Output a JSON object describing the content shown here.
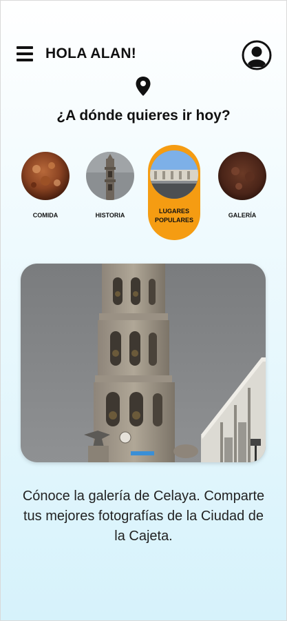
{
  "header": {
    "greeting": "HOLA ALAN!"
  },
  "prompt": "¿A dónde quieres ir hoy?",
  "categories": [
    {
      "label": "COMIDA"
    },
    {
      "label": "HISTORIA"
    },
    {
      "label": "LUGARES POPULARES",
      "selected": true
    },
    {
      "label": "GALERÍA"
    }
  ],
  "description": "Cónoce la galería de Celaya. Comparte tus mejores fotografías de la Ciudad de la Cajeta.",
  "colors": {
    "accent": "#f59c12",
    "background_top": "#ffffff",
    "background_bottom": "#d6f2fb"
  },
  "icons": [
    "menu-icon",
    "user-profile-icon",
    "location-pin-icon"
  ]
}
